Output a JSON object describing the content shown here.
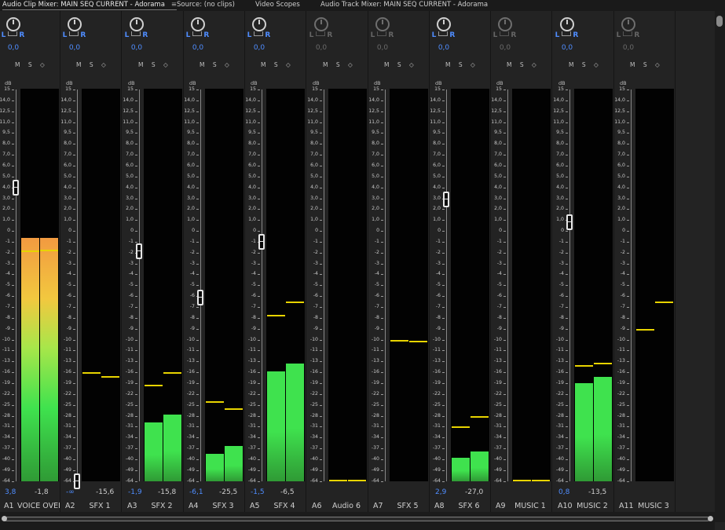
{
  "tabs": [
    {
      "label": "Audio Clip Mixer: MAIN SEQ CURRENT - Adorama",
      "active": true,
      "menu": "≡"
    },
    {
      "label": "Source: (no clips)"
    },
    {
      "label": "Video Scopes"
    },
    {
      "label": "Audio Track Mixer: MAIN SEQ CURRENT - Adorama"
    }
  ],
  "db_label": "dB",
  "msr_label": "M S ◇",
  "lr_labels": {
    "left": "L",
    "right": "R"
  },
  "scale_ticks": [
    "15",
    "14,0",
    "12,5",
    "11,0",
    "9,5",
    "8,0",
    "7,0",
    "6,0",
    "5,0",
    "4,0",
    "3,0",
    "2,0",
    "1,0",
    "0",
    "-1",
    "-2",
    "-3",
    "-4",
    "-5",
    "-6",
    "-7",
    "-8",
    "-9",
    "-10",
    "-11",
    "-13",
    "-16",
    "-19",
    "-22",
    "-25",
    "-28",
    "-31",
    "-34",
    "-37",
    "-40",
    "-49",
    "-64"
  ],
  "colors": {
    "accent": "#4f8dff",
    "meter_green": "#3fe24e",
    "meter_hot": "#f29a40",
    "peak": "#e8d400"
  },
  "channels": [
    {
      "id": "A1",
      "name": "VOICE OVER",
      "pan": "0,0",
      "volume": "3,8",
      "volume_blue": true,
      "meter_db": "-1,8",
      "enabled": true,
      "fader_db": 4.0,
      "levels": [
        0.62,
        0.62
      ],
      "peaks": [
        -1.8,
        -1.7
      ],
      "hot": true
    },
    {
      "id": "A2",
      "name": "SFX 1",
      "pan": "0,0",
      "volume": "-∞",
      "volume_blue": true,
      "meter_db": "-15,6",
      "enabled": true,
      "fader_db": -64,
      "levels": [
        0,
        0
      ],
      "peaks": [
        -16.0,
        -17.0
      ]
    },
    {
      "id": "A3",
      "name": "SFX 2",
      "pan": "0,0",
      "volume": "-1,9",
      "volume_blue": true,
      "meter_db": "-15,8",
      "enabled": true,
      "fader_db": -1.9,
      "levels": [
        0.15,
        0.17
      ],
      "peaks": [
        -19.5,
        -16.0
      ]
    },
    {
      "id": "A4",
      "name": "SFX 3",
      "pan": "0,0",
      "volume": "-6,1",
      "volume_blue": true,
      "meter_db": "-25,5",
      "enabled": true,
      "fader_db": -6.1,
      "levels": [
        0.07,
        0.09
      ],
      "peaks": [
        -24.0,
        -26.0
      ]
    },
    {
      "id": "A5",
      "name": "SFX 4",
      "pan": "0,0",
      "volume": "-1,5",
      "volume_blue": true,
      "meter_db": "-6,5",
      "enabled": true,
      "fader_db": -1.0,
      "levels": [
        0.28,
        0.3
      ],
      "peaks": [
        -7.7,
        -6.5
      ]
    },
    {
      "id": "A6",
      "name": "Audio 6",
      "pan": "0,0",
      "volume": "",
      "volume_blue": false,
      "meter_db": "",
      "enabled": false,
      "fader_db": null,
      "levels": [
        0,
        0
      ],
      "peaks": [
        -64,
        -64
      ]
    },
    {
      "id": "A7",
      "name": "SFX 5",
      "pan": "0,0",
      "volume": "",
      "volume_blue": false,
      "meter_db": "",
      "enabled": false,
      "fader_db": null,
      "levels": [
        0,
        0
      ],
      "peaks": [
        -10.0,
        -10.1
      ]
    },
    {
      "id": "A8",
      "name": "SFX 6",
      "pan": "0,0",
      "volume": "2,9",
      "volume_blue": true,
      "meter_db": "-27,0",
      "enabled": true,
      "fader_db": 2.9,
      "levels": [
        0.06,
        0.075
      ],
      "peaks": [
        -31.0,
        -28.0
      ]
    },
    {
      "id": "A9",
      "name": "MUSIC 1",
      "pan": "0,0",
      "volume": "",
      "volume_blue": false,
      "meter_db": "",
      "enabled": false,
      "fader_db": null,
      "levels": [
        0,
        0
      ],
      "peaks": [
        -64,
        -64
      ]
    },
    {
      "id": "A10",
      "name": "MUSIC 2",
      "pan": "0,0",
      "volume": "0,8",
      "volume_blue": true,
      "meter_db": "-13,5",
      "enabled": true,
      "fader_db": 0.8,
      "levels": [
        0.25,
        0.265
      ],
      "peaks": [
        -14.0,
        -13.3
      ]
    },
    {
      "id": "A11",
      "name": "MUSIC 3",
      "pan": "0,0",
      "volume": "",
      "volume_blue": false,
      "meter_db": "",
      "enabled": false,
      "fader_db": null,
      "levels": [
        0,
        0
      ],
      "peaks": [
        -9.0,
        -6.5
      ]
    }
  ]
}
